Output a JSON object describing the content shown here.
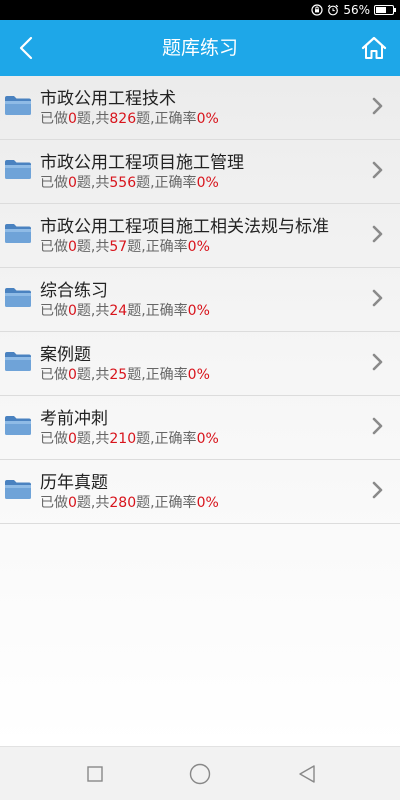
{
  "status": {
    "battery": "56%",
    "battery_level": 0.56
  },
  "header": {
    "title": "题库练习"
  },
  "stats_labels": {
    "done_prefix": "已做",
    "done_suffix": "题,共",
    "total_suffix": "题,正确率"
  },
  "items": [
    {
      "title": "市政公用工程技术",
      "done": "0",
      "total": "826",
      "accuracy": "0%"
    },
    {
      "title": "市政公用工程项目施工管理",
      "done": "0",
      "total": "556",
      "accuracy": "0%"
    },
    {
      "title": "市政公用工程项目施工相关法规与标准",
      "done": "0",
      "total": "57",
      "accuracy": "0%"
    },
    {
      "title": "综合练习",
      "done": "0",
      "total": "24",
      "accuracy": "0%"
    },
    {
      "title": "案例题",
      "done": "0",
      "total": "25",
      "accuracy": "0%"
    },
    {
      "title": "考前冲刺",
      "done": "0",
      "total": "210",
      "accuracy": "0%"
    },
    {
      "title": "历年真题",
      "done": "0",
      "total": "280",
      "accuracy": "0%"
    }
  ],
  "icons": {
    "back": "back-icon",
    "home": "home-icon",
    "folder": "folder-icon",
    "chevron": "chevron-right-icon",
    "recents": "square-icon",
    "nav_home": "circle-icon",
    "nav_back": "triangle-back-icon",
    "alarm": "alarm-clock-icon",
    "lock": "rotation-lock-icon"
  },
  "colors": {
    "header_bg": "#1ea7e8",
    "highlight": "#d8141c",
    "text": "#222222",
    "subtext": "#666666"
  }
}
